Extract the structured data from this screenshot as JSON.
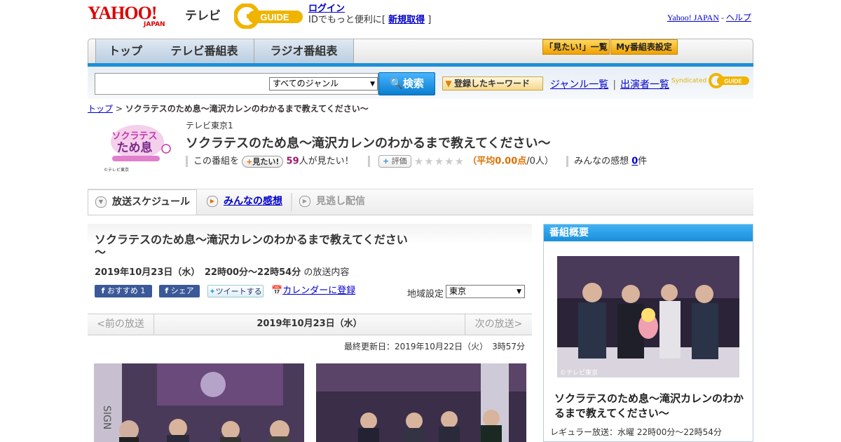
{
  "header": {
    "logo_text": "YAHOO!",
    "logo_sub": "JAPAN",
    "section": "テレビ",
    "gguide_text": "GUIDE",
    "login_label": "ログイン",
    "login_desc_pre": "IDでもっと便利に[ ",
    "signup_label": "新規取得",
    "login_desc_post": " ]",
    "yahoo_japan_link": "Yahoo! JAPAN",
    "link_sep": " - ",
    "help_link": "ヘルプ"
  },
  "nav": {
    "tabs": [
      {
        "label": "トップ"
      },
      {
        "label": "テレビ番組表"
      },
      {
        "label": "ラジオ番組表"
      }
    ],
    "mitai_list": "「見たい!」一覧",
    "my_tv": "My番組表設定"
  },
  "search": {
    "genre_selected": "すべてのジャンル",
    "button_label": "検索",
    "keyword_button": "登録したキーワード",
    "genre_list_link": "ジャンル一覧",
    "performer_list_link": "出演者一覧",
    "syndicated": "Syndicated",
    "syndicated_brand": "GUIDE"
  },
  "breadcrumb": {
    "top": "トップ",
    "sep": " > ",
    "current": "ソクラテスのため息～滝沢カレンのわかるまで教えてください～"
  },
  "program": {
    "channel": "テレビ東京1",
    "title": "ソクラテスのため息～滝沢カレンのわかるまで教えてください～",
    "this_program": "この番組を",
    "mitai_btn": "見たい!",
    "mitai_count": "59",
    "mitai_suffix": "人が見たい！",
    "eval_btn": "評価",
    "stars": "★★★★★",
    "avg_open": "（",
    "avg_label": "平均0.00点",
    "avg_people": "/0人）",
    "impressions_label": "みんなの感想",
    "impressions_count": "0",
    "impressions_suffix": "件",
    "thumb_copyright": "©テレビ東京"
  },
  "tabs2": {
    "schedule": "放送スケジュール",
    "impressions": "みんなの感想",
    "vod": "見逃し配信"
  },
  "broadcast": {
    "title": "ソクラテスのため息～滝沢カレンのわかるまで教えてください～",
    "date_time": "2019年10月23日（水）　22時00分～22時54分",
    "date_suffix": "の放送内容",
    "recommend": "おすすめ 1",
    "share": "シェア",
    "tweet": "ツイートする",
    "calendar": "カレンダーに登録",
    "region_label": "地域設定",
    "region_value": "東京",
    "prev": "<前の放送",
    "current_date": "2019年10月23日（水）",
    "next": "次の放送>",
    "updated": "最終更新日：2019年10月22日（火）　3時57分"
  },
  "sidebar": {
    "heading": "番組概要",
    "image_copyright": "©テレビ東京",
    "title": "ソクラテスのため息～滝沢カレンのわかるまで教えてください～",
    "regular": "レギュラー放送：水曜 22時00分～22時54分"
  },
  "colors": {
    "accent_blue": "#1c8fd6",
    "yahoo_red": "#dd0000",
    "link": "#0000cc",
    "orange": "#e07000"
  }
}
